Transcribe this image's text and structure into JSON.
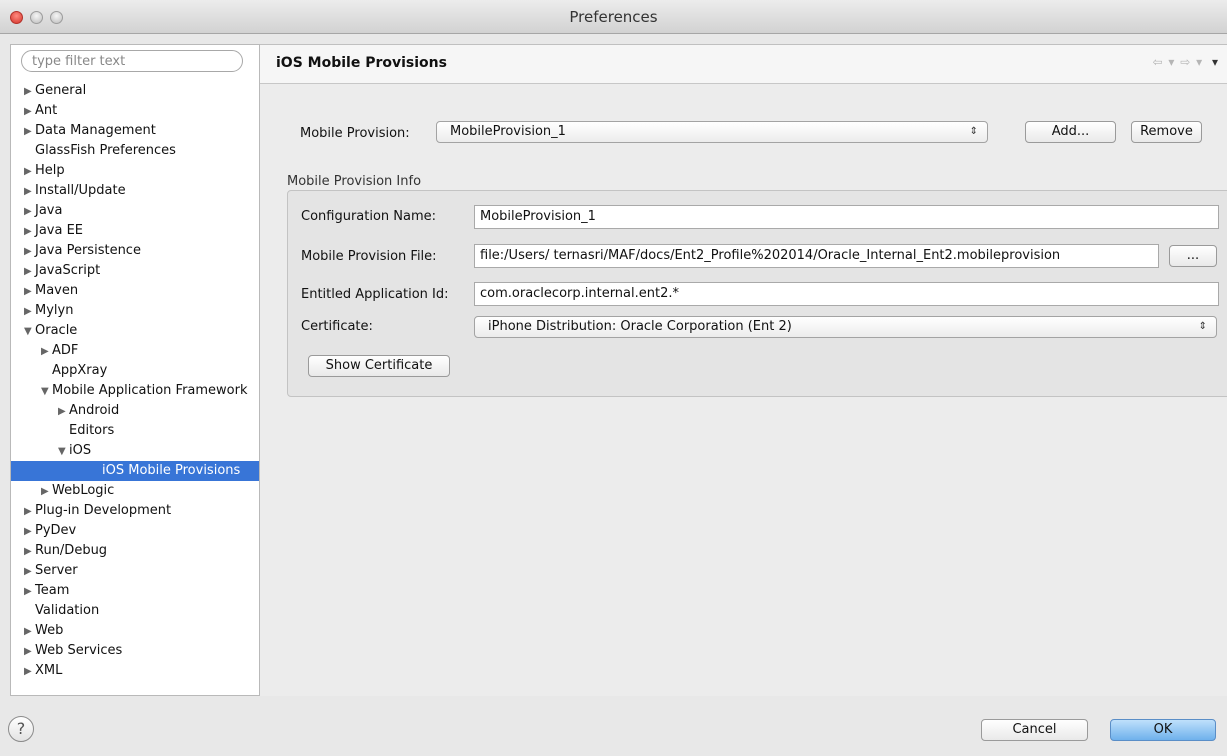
{
  "window": {
    "title": "Preferences"
  },
  "sidebar": {
    "filter_placeholder": "type filter text",
    "items": [
      {
        "label": "General",
        "arrow": "▶",
        "indent": 0
      },
      {
        "label": "Ant",
        "arrow": "▶",
        "indent": 0
      },
      {
        "label": "Data Management",
        "arrow": "▶",
        "indent": 0
      },
      {
        "label": "GlassFish Preferences",
        "arrow": "",
        "indent": 0
      },
      {
        "label": "Help",
        "arrow": "▶",
        "indent": 0
      },
      {
        "label": "Install/Update",
        "arrow": "▶",
        "indent": 0
      },
      {
        "label": "Java",
        "arrow": "▶",
        "indent": 0
      },
      {
        "label": "Java EE",
        "arrow": "▶",
        "indent": 0
      },
      {
        "label": "Java Persistence",
        "arrow": "▶",
        "indent": 0
      },
      {
        "label": "JavaScript",
        "arrow": "▶",
        "indent": 0
      },
      {
        "label": "Maven",
        "arrow": "▶",
        "indent": 0
      },
      {
        "label": "Mylyn",
        "arrow": "▶",
        "indent": 0
      },
      {
        "label": "Oracle",
        "arrow": "▼",
        "indent": 0
      },
      {
        "label": "ADF",
        "arrow": "▶",
        "indent": 1
      },
      {
        "label": "AppXray",
        "arrow": "",
        "indent": 1
      },
      {
        "label": "Mobile Application Framework",
        "arrow": "▼",
        "indent": 1
      },
      {
        "label": "Android",
        "arrow": "▶",
        "indent": 2
      },
      {
        "label": "Editors",
        "arrow": "",
        "indent": 2
      },
      {
        "label": "iOS",
        "arrow": "▼",
        "indent": 2
      },
      {
        "label": "iOS Mobile Provisions",
        "arrow": "",
        "indent": 3,
        "selected": true
      },
      {
        "label": "WebLogic",
        "arrow": "▶",
        "indent": 1
      },
      {
        "label": "Plug-in Development",
        "arrow": "▶",
        "indent": 0
      },
      {
        "label": "PyDev",
        "arrow": "▶",
        "indent": 0
      },
      {
        "label": "Run/Debug",
        "arrow": "▶",
        "indent": 0
      },
      {
        "label": "Server",
        "arrow": "▶",
        "indent": 0
      },
      {
        "label": "Team",
        "arrow": "▶",
        "indent": 0
      },
      {
        "label": "Validation",
        "arrow": "",
        "indent": 0
      },
      {
        "label": "Web",
        "arrow": "▶",
        "indent": 0
      },
      {
        "label": "Web Services",
        "arrow": "▶",
        "indent": 0
      },
      {
        "label": "XML",
        "arrow": "▶",
        "indent": 0
      }
    ]
  },
  "page": {
    "title": "iOS Mobile Provisions",
    "nav_back": "⇦",
    "nav_forward": "⇨",
    "nav_menu": "▾",
    "mobile_provision_label": "Mobile Provision:",
    "mobile_provision_value": "MobileProvision_1",
    "add_label": "Add...",
    "remove_label": "Remove",
    "group_title": "Mobile Provision Info",
    "config_name_label": "Configuration Name:",
    "config_name_value": "MobileProvision_1",
    "provision_file_label": "Mobile Provision File:",
    "provision_file_value": "file:/Users/ ternasri/MAF/docs/Ent2_Profile%202014/Oracle_Internal_Ent2.mobileprovision",
    "browse_label": "...",
    "app_id_label": "Entitled Application Id:",
    "app_id_value": "com.oraclecorp.internal.ent2.*",
    "certificate_label": "Certificate:",
    "certificate_value": "iPhone Distribution: Oracle Corporation (Ent 2)",
    "show_certificate_label": "Show Certificate"
  },
  "footer": {
    "help_glyph": "?",
    "cancel_label": "Cancel",
    "ok_label": "OK"
  },
  "colors": {
    "selection": "#3875d7",
    "ok_button": "#6fb1ec"
  }
}
